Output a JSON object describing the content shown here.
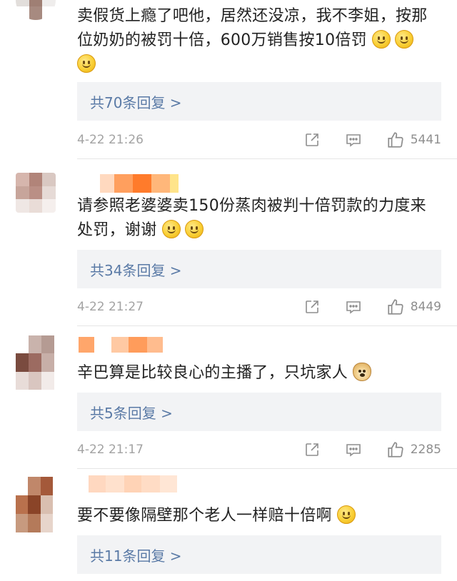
{
  "comments": [
    {
      "text": "卖假货上瘾了吧他，居然还没凉，我不李姐，按那位奶奶的被罚十倍，600万销售按10倍罚",
      "emojis": [
        "smile-emoji",
        "smile-emoji",
        "smile-emoji"
      ],
      "replies": "共70条回复 >",
      "time": "4-22 21:26",
      "likes": "5441"
    },
    {
      "text": "请参照老婆婆卖150份蒸肉被判十倍罚款的力度来处罚，谢谢",
      "emojis": [
        "smile-emoji",
        "smile-emoji"
      ],
      "replies": "共34条回复 >",
      "time": "4-22 21:27",
      "likes": "8449"
    },
    {
      "text": "辛巴算是比较良心的主播了，只坑家人",
      "emojis": [
        "doge-emoji"
      ],
      "replies": "共5条回复 >",
      "time": "4-22 21:17",
      "likes": "2285"
    },
    {
      "text": "要不要像隔壁那个老人一样赔十倍啊",
      "emojis": [
        "smile-emoji"
      ],
      "replies": "共11条回复 >"
    }
  ],
  "icons": {
    "share": "share-icon",
    "comment": "comment-icon",
    "like": "thumbs-up-icon"
  },
  "colors": {
    "link": "#5a7aa6",
    "reply_bg": "#f2f3f5",
    "meta": "#a3a3a3"
  }
}
